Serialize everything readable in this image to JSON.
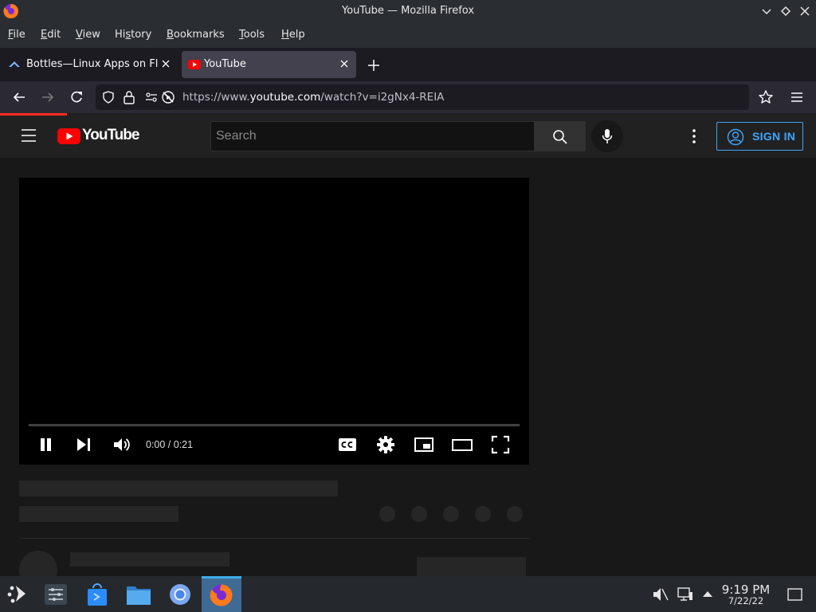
{
  "window": {
    "title": "YouTube — Mozilla Firefox"
  },
  "menu": [
    "File",
    "Edit",
    "View",
    "History",
    "Bookmarks",
    "Tools",
    "Help"
  ],
  "menu_mnemonics": [
    "F",
    "E",
    "V",
    "s",
    "B",
    "T",
    "H"
  ],
  "tabs": [
    {
      "label": "Bottles—Linux Apps on Fla",
      "active": false,
      "icon": "bottles-icon"
    },
    {
      "label": "YouTube",
      "active": true,
      "icon": "youtube-icon"
    }
  ],
  "urlbar": {
    "prefix": "https://www.",
    "domain": "youtube.com",
    "path": "/watch?v=i2gNx4-REIA"
  },
  "youtube": {
    "logo_text": "YouTube",
    "search_placeholder": "Search",
    "signin_label": "SIGN IN"
  },
  "player": {
    "time_display": "0:00 / 0:21",
    "progress": 0.0
  },
  "taskbar": {
    "time": "9:19 PM",
    "date": "7/22/22",
    "apps": [
      "application-launcher-icon",
      "system-settings-icon",
      "discover-store-icon",
      "dolphin-files-icon",
      "chromium-icon",
      "firefox-icon"
    ]
  },
  "colors": {
    "accent_blue": "#3ea6ff",
    "youtube_red": "#ff0000",
    "loading_red": "#ff2a1f"
  }
}
